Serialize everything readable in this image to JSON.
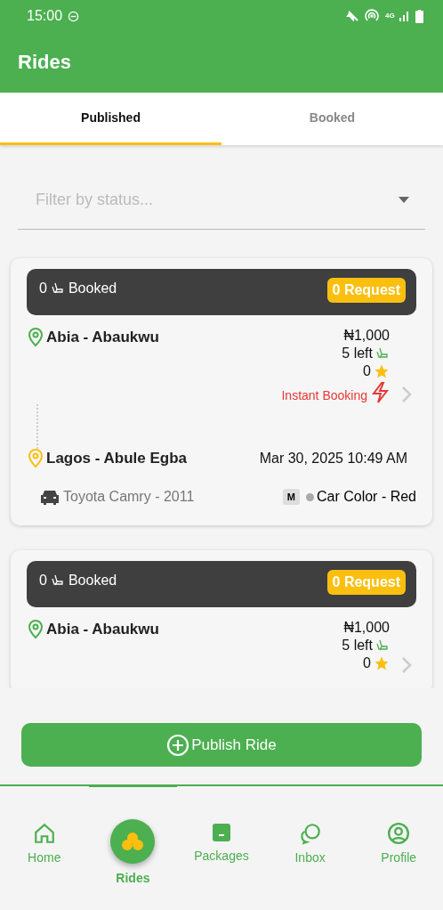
{
  "status_bar": {
    "time": "15:00",
    "network": "4G"
  },
  "header": {
    "title": "Rides"
  },
  "tabs": [
    {
      "label": "Published",
      "selected": true
    },
    {
      "label": "Booked",
      "selected": false
    }
  ],
  "filter": {
    "placeholder": "Filter by status..."
  },
  "rides": [
    {
      "booked": "0",
      "booked_label": "Booked",
      "requests": "0 Request",
      "origin": "Abia - Abaukwu",
      "price": "₦1,000",
      "seats_left": "5 left",
      "rating": "0",
      "instant_label": "Instant Booking",
      "destination": "Lagos - Abule Egba",
      "date": "Mar 30, 2025 10:49 AM",
      "car": "Toyota  Camry - 2011",
      "transmission": "M",
      "car_color": "Car Color - Red"
    },
    {
      "booked": "0",
      "booked_label": "Booked",
      "requests": "0 Request",
      "origin": "Abia - Abaukwu",
      "price": "₦1,000",
      "seats_left": "5 left",
      "rating": "0"
    }
  ],
  "publish_button": {
    "label": "Publish Ride"
  },
  "nav": [
    {
      "label": "Home",
      "kind": "home",
      "selected": false
    },
    {
      "label": "Rides",
      "kind": "rides",
      "selected": true
    },
    {
      "label": "Packages",
      "kind": "package",
      "selected": false
    },
    {
      "label": "Inbox",
      "kind": "chat",
      "selected": false
    },
    {
      "label": "Profile",
      "kind": "profile",
      "selected": false
    }
  ]
}
